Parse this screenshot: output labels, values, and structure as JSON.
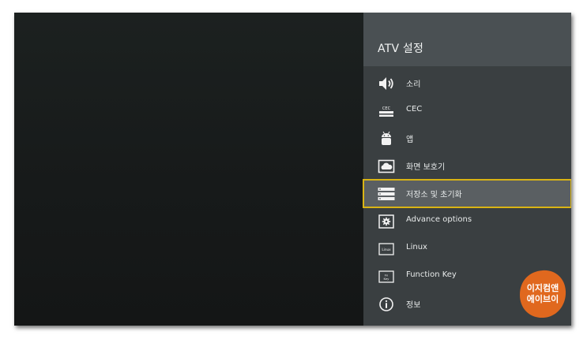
{
  "panel": {
    "title": "ATV 설정"
  },
  "menu": {
    "items": [
      {
        "label": "소리",
        "icon": "speaker-icon"
      },
      {
        "label": "CEC",
        "icon": "cec-icon"
      },
      {
        "label": "앱",
        "icon": "android-icon"
      },
      {
        "label": "화면 보호기",
        "icon": "screensaver-icon"
      },
      {
        "label": "저장소 및 초기화",
        "icon": "storage-icon",
        "selected": true
      },
      {
        "label": "Advance options",
        "icon": "advance-options-icon"
      },
      {
        "label": "Linux",
        "icon": "linux-icon"
      },
      {
        "label": "Function Key",
        "icon": "function-key-icon"
      },
      {
        "label": "정보",
        "icon": "info-icon"
      }
    ],
    "icon_labels": {
      "cec": "CEC",
      "linux": "Linux",
      "fn_line1": "Fn",
      "fn_line2": "Key"
    }
  },
  "watermark": {
    "line1": "이지컴앤",
    "line2": "에이브이"
  },
  "colors": {
    "panel_bg": "#3a3f41",
    "header_bg": "#4a5053",
    "highlight_border": "#d9b414",
    "watermark": "#e0681e"
  }
}
